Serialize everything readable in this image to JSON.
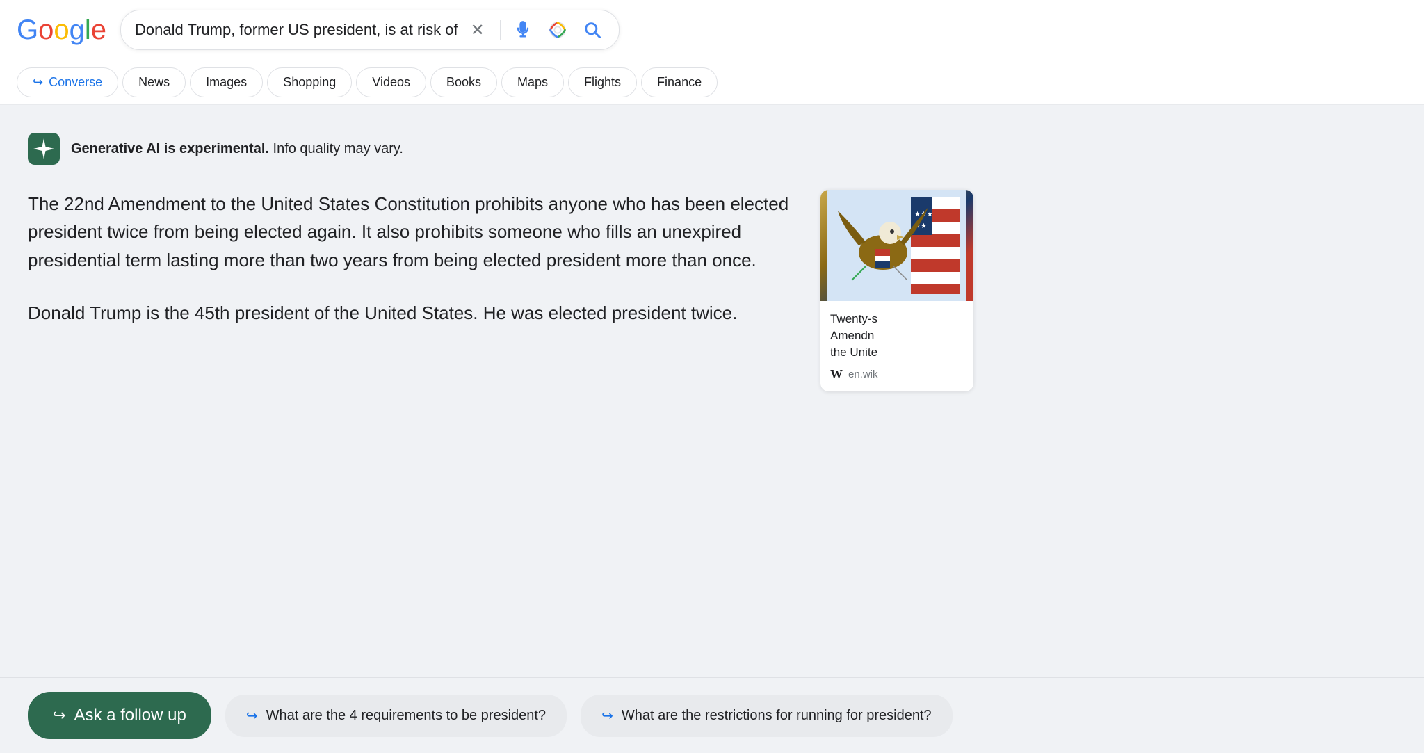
{
  "header": {
    "logo": "Google",
    "search_query": "Donald Trump, former US president, is at risk of"
  },
  "nav": {
    "tabs": [
      {
        "id": "converse",
        "label": "Converse",
        "active": false,
        "has_arrow": true
      },
      {
        "id": "news",
        "label": "News",
        "active": false
      },
      {
        "id": "images",
        "label": "Images",
        "active": false
      },
      {
        "id": "shopping",
        "label": "Shopping",
        "active": false
      },
      {
        "id": "videos",
        "label": "Videos",
        "active": false
      },
      {
        "id": "books",
        "label": "Books",
        "active": false
      },
      {
        "id": "maps",
        "label": "Maps",
        "active": false
      },
      {
        "id": "flights",
        "label": "Flights",
        "active": false
      },
      {
        "id": "finance",
        "label": "Finance",
        "active": false
      }
    ]
  },
  "ai_section": {
    "notice_bold": "Generative AI is experimental.",
    "notice_rest": " Info quality may vary.",
    "paragraph1": "The 22nd Amendment to the United States Constitution prohibits anyone who has been elected president twice from being elected again. It also prohibits someone who fills an unexpired presidential term lasting more than two years from being elected president more than once.",
    "paragraph2": "Donald Trump is the 45th president of the United States. He was elected president twice."
  },
  "sidebar_card": {
    "title": "Twenty-s\nAmendr\nthe Unite",
    "source_icon": "W",
    "source_url": "en.wik"
  },
  "bottom_bar": {
    "ask_followup_label": "Ask a follow up",
    "suggestion1": "What are the 4 requirements to be president?",
    "suggestion2": "What are the restrictions for running for president?"
  }
}
